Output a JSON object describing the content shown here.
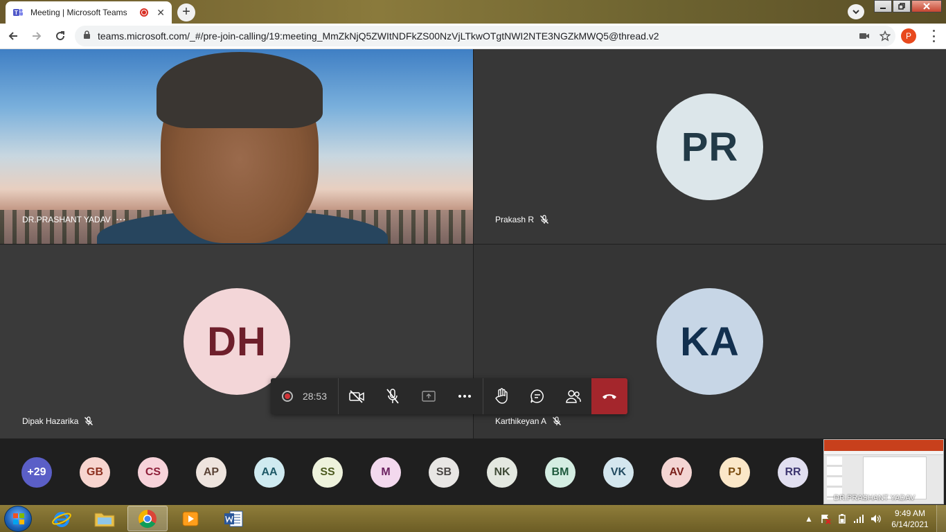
{
  "browser": {
    "tab_title": "Meeting | Microsoft Teams",
    "tab_close": "✕",
    "new_tab": "+",
    "url": "teams.microsoft.com/_#/pre-join-calling/19:meeting_MmZkNjQ5ZWItNDFkZS00NzVjLTkwOTgtNWI2NTE3NGZkMWQ5@thread.v2",
    "profile_initial": "P"
  },
  "tiles": [
    {
      "name": "DR.PRASHANT YADAV",
      "more": "···",
      "type": "video"
    },
    {
      "name": "Prakash R",
      "initials": "PR",
      "bg": "#dce6ea",
      "fg": "#223a47",
      "muted": true
    },
    {
      "name": "Dipak Hazarika",
      "initials": "DH",
      "bg": "#f3d6d8",
      "fg": "#6e1f2b",
      "muted": true
    },
    {
      "name": "Karthikeyan A",
      "initials": "KA",
      "bg": "#c7d6e6",
      "fg": "#12304f",
      "muted": true
    }
  ],
  "controls": {
    "timer": "28:53"
  },
  "participants": [
    {
      "label": "+29",
      "bg": "#5b5fc7",
      "fg": "#ffffff"
    },
    {
      "label": "GB",
      "bg": "#f7d5cf",
      "fg": "#8b2f1f"
    },
    {
      "label": "CS",
      "bg": "#f7d3da",
      "fg": "#8e1f3a"
    },
    {
      "label": "AP",
      "bg": "#eee4de",
      "fg": "#5a4336"
    },
    {
      "label": "AA",
      "bg": "#cfeaf0",
      "fg": "#1d5866"
    },
    {
      "label": "SS",
      "bg": "#eef2dc",
      "fg": "#4c5a1f"
    },
    {
      "label": "M",
      "bg": "#f3d9ee",
      "fg": "#6b2261"
    },
    {
      "label": "SB",
      "bg": "#e8e6e4",
      "fg": "#4a4644"
    },
    {
      "label": "NK",
      "bg": "#e4e8e0",
      "fg": "#3f4a36"
    },
    {
      "label": "BM",
      "bg": "#d4ede2",
      "fg": "#1f5a3e"
    },
    {
      "label": "VK",
      "bg": "#d4e6ee",
      "fg": "#224a60"
    },
    {
      "label": "AV",
      "bg": "#f4d5d3",
      "fg": "#7a1f1a"
    },
    {
      "label": "PJ",
      "bg": "#fbe7c8",
      "fg": "#7a4b0d"
    },
    {
      "label": "RR",
      "bg": "#e1dff0",
      "fg": "#3d3670"
    }
  ],
  "share_preview": {
    "presenter": "DR.PRASHANT YADAV"
  },
  "taskbar": {
    "time": "9:49 AM",
    "date": "6/14/2021",
    "tray_arrow": "▲"
  }
}
